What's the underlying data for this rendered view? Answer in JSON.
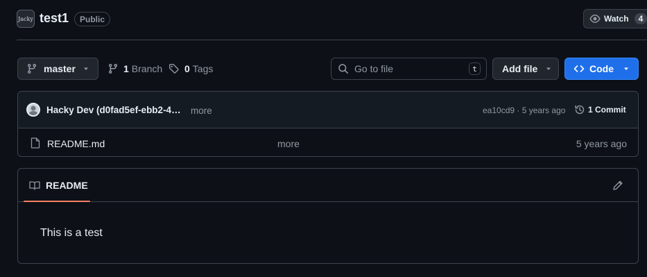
{
  "repo": {
    "avatar_text": "Jacky",
    "name": "test1",
    "visibility": "Public"
  },
  "watch": {
    "label": "Watch",
    "count": "4"
  },
  "toolbar": {
    "branch": "master",
    "branches_count": "1",
    "branches_label": "Branch",
    "tags_count": "0",
    "tags_label": "Tags",
    "search_placeholder": "Go to file",
    "search_shortcut": "t",
    "add_file_label": "Add file",
    "code_label": "Code"
  },
  "commit": {
    "author": "Hacky Dev (d0fad5ef-ebb2-4…",
    "more": "more",
    "hash_time": "ea10cd9 · 5 years ago",
    "commits_label": "1 Commit"
  },
  "files": [
    {
      "name": "README.md",
      "message": "more",
      "time": "5 years ago"
    }
  ],
  "readme": {
    "tab_label": "README",
    "content": "This is a test"
  },
  "colors": {
    "background": "#0d1117",
    "primary_button": "#1f6feb",
    "tab_underline": "#f78166"
  }
}
